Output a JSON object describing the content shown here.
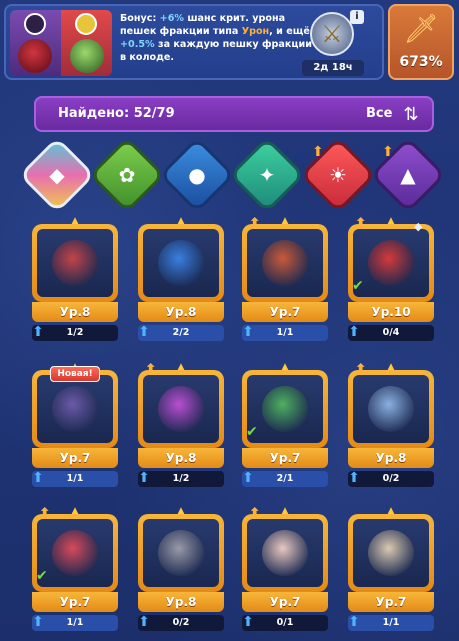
{
  "banner": {
    "bonus_parts": [
      {
        "t": "Бонус: ",
        "c": "w"
      },
      {
        "t": "+6%",
        "c": "b"
      },
      {
        "t": " шанс крит. урона пешек фракции типа ",
        "c": "w"
      },
      {
        "t": "Урон",
        "c": "o"
      },
      {
        "t": ", и ещё ",
        "c": "w"
      },
      {
        "t": "+0.5%",
        "c": "b"
      },
      {
        "t": " за каждую пешку фракции в колоде.",
        "c": "w"
      }
    ],
    "info_icon": "i",
    "timer": "2д 18ч",
    "power_value": "673%"
  },
  "found": {
    "label": "Найдено: 52/79",
    "filter": "Все"
  },
  "factions": [
    {
      "name": "all",
      "icon": "◆"
    },
    {
      "name": "nature",
      "icon": "✿"
    },
    {
      "name": "dark",
      "icon": "●"
    },
    {
      "name": "holy",
      "icon": "✦"
    },
    {
      "name": "fire",
      "icon": "☀"
    },
    {
      "name": "shadow",
      "icon": "▲"
    }
  ],
  "cards": [
    {
      "level": "Ур.8",
      "count": "1/2",
      "full": false,
      "hero_color": "#c2444a",
      "upgrade": false,
      "check": false,
      "new": false
    },
    {
      "level": "Ур.8",
      "count": "2/2",
      "full": true,
      "hero_color": "#3a7fe0",
      "upgrade": false,
      "check": false,
      "new": false
    },
    {
      "level": "Ур.7",
      "count": "1/1",
      "full": true,
      "hero_color": "#c95a3a",
      "upgrade": true,
      "check": false,
      "new": false
    },
    {
      "level": "Ур.10",
      "count": "0/4",
      "full": false,
      "hero_color": "#d33a3a",
      "upgrade": true,
      "check": true,
      "new": false,
      "lock": true
    },
    {
      "level": "Ур.7",
      "count": "1/1",
      "full": true,
      "hero_color": "#6b5aa8",
      "upgrade": false,
      "check": false,
      "new": true
    },
    {
      "level": "Ур.8",
      "count": "1/2",
      "full": false,
      "hero_color": "#b84fd0",
      "upgrade": true,
      "check": false,
      "new": false
    },
    {
      "level": "Ур.7",
      "count": "2/1",
      "full": true,
      "hero_color": "#4fb060",
      "upgrade": false,
      "check": true,
      "new": false
    },
    {
      "level": "Ур.8",
      "count": "0/2",
      "full": false,
      "hero_color": "#8ab0e0",
      "upgrade": true,
      "check": false,
      "new": false
    },
    {
      "level": "Ур.7",
      "count": "1/1",
      "full": true,
      "hero_color": "#d84a5a",
      "upgrade": true,
      "check": true,
      "new": false
    },
    {
      "level": "Ур.8",
      "count": "0/2",
      "full": false,
      "hero_color": "#9a9aa8",
      "upgrade": false,
      "check": false,
      "new": false
    },
    {
      "level": "Ур.7",
      "count": "0/1",
      "full": false,
      "hero_color": "#e8c8c0",
      "upgrade": true,
      "check": false,
      "new": false
    },
    {
      "level": "Ур.7",
      "count": "1/1",
      "full": true,
      "hero_color": "#d9c9b0",
      "upgrade": false,
      "check": false,
      "new": false
    }
  ]
}
